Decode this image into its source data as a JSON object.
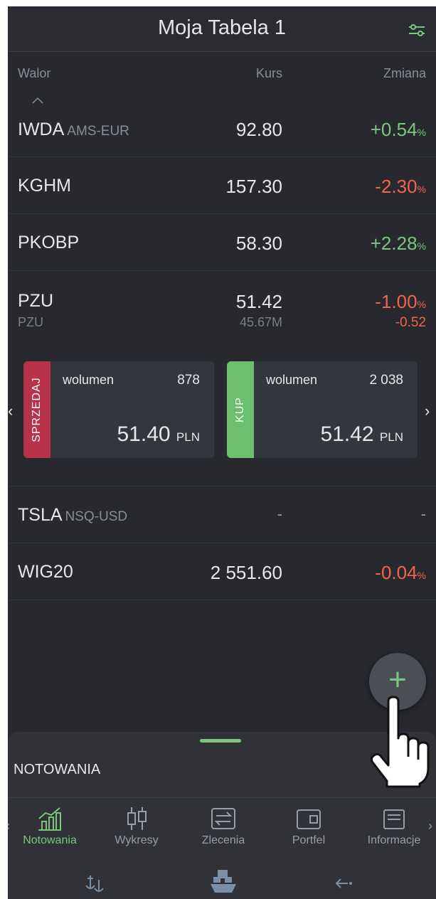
{
  "header": {
    "title": "Moja Tabela 1",
    "settings_icon": "sliders-icon"
  },
  "columns": {
    "walor": "Walor",
    "kurs": "Kurs",
    "zmiana": "Zmiana",
    "sort_icon": "caret-up-icon"
  },
  "rows": [
    {
      "symbol": "IWDA",
      "exchange": "AMS-EUR",
      "price": "92.80",
      "change": "+0.54",
      "unit": "%",
      "direction": "up"
    },
    {
      "symbol": "KGHM",
      "exchange": "",
      "price": "157.30",
      "change": "-2.30",
      "unit": "%",
      "direction": "down"
    },
    {
      "symbol": "PKOBP",
      "exchange": "",
      "price": "58.30",
      "change": "+2.28",
      "unit": "%",
      "direction": "up"
    },
    {
      "symbol": "PZU",
      "subname": "PZU",
      "price": "51.42",
      "volume": "45.67M",
      "change": "-1.00",
      "unit": "%",
      "change_abs": "-0.52",
      "direction": "down"
    },
    {
      "symbol": "TSLA",
      "exchange": "NSQ-USD",
      "price": "-",
      "change": "-",
      "unit": "",
      "direction": "none"
    },
    {
      "symbol": "WIG20",
      "exchange": "",
      "price": "2 551.60",
      "change": "-0.04",
      "unit": "%",
      "direction": "down"
    }
  ],
  "order_book": {
    "sell": {
      "tab": "SPRZEDAJ",
      "volume_label": "wolumen",
      "volume": "878",
      "price": "51.40",
      "currency": "PLN"
    },
    "buy": {
      "tab": "KUP",
      "volume_label": "wolumen",
      "volume": "2 038",
      "price": "51.42",
      "currency": "PLN"
    },
    "prev_icon": "chevron-left-icon",
    "next_icon": "chevron-right-icon"
  },
  "fab": {
    "label": "+",
    "icon": "plus-icon"
  },
  "sheet": {
    "title": "NOTOWANIA",
    "nav": [
      {
        "label": "Notowania",
        "icon": "chart-up-icon",
        "active": true
      },
      {
        "label": "Wykresy",
        "icon": "candlestick-icon",
        "active": false
      },
      {
        "label": "Zlecenia",
        "icon": "exchange-icon",
        "active": false
      },
      {
        "label": "Portfel",
        "icon": "wallet-icon",
        "active": false
      },
      {
        "label": "Informacje",
        "icon": "news-icon",
        "active": false
      }
    ],
    "bottom_icons": [
      "anchor-icon",
      "ship-icon",
      "back-arrow-icon"
    ]
  },
  "colors": {
    "positive": "#7bc67e",
    "negative": "#f0644e",
    "sell": "#b8334a",
    "buy": "#6cbf6c",
    "background": "#27292e"
  }
}
